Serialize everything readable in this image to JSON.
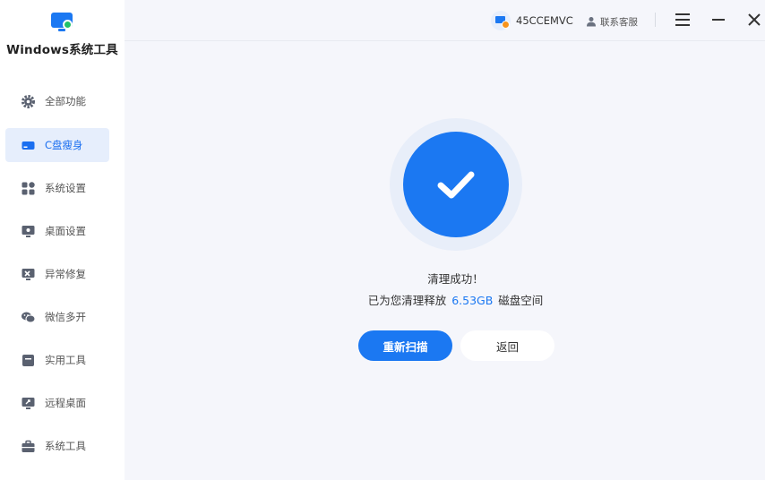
{
  "app": {
    "title": "Windows系统工具"
  },
  "sidebar": {
    "items": [
      {
        "label": "全部功能",
        "icon": "gear-icon",
        "active": false
      },
      {
        "label": "C盘瘦身",
        "icon": "drive-icon",
        "active": true
      },
      {
        "label": "系统设置",
        "icon": "grid-icon",
        "active": false
      },
      {
        "label": "桌面设置",
        "icon": "desktop-icon",
        "active": false
      },
      {
        "label": "异常修复",
        "icon": "repair-icon",
        "active": false
      },
      {
        "label": "微信多开",
        "icon": "wechat-icon",
        "active": false
      },
      {
        "label": "实用工具",
        "icon": "toolbox-icon",
        "active": false
      },
      {
        "label": "远程桌面",
        "icon": "remote-desktop-icon",
        "active": false
      },
      {
        "label": "系统工具",
        "icon": "briefcase-icon",
        "active": false
      }
    ]
  },
  "header": {
    "account_name": "45CCEMVC",
    "support_label": "联系客服"
  },
  "result": {
    "title": "清理成功！",
    "detail_prefix": "已为您清理释放",
    "freed_size": "6.53GB",
    "detail_suffix": "磁盘空间"
  },
  "actions": {
    "rescan_label": "重新扫描",
    "back_label": "返回"
  },
  "colors": {
    "accent": "#1b78f2",
    "active_bg": "#e6eefc",
    "badge_orange": "#f7941d",
    "logo_green": "#21c16b"
  }
}
